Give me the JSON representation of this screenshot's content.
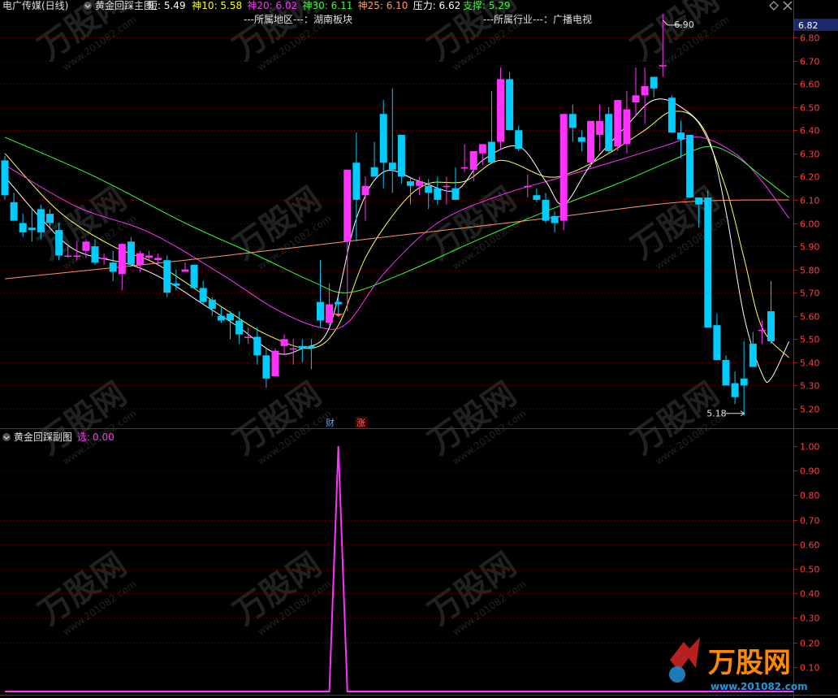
{
  "header": {
    "stock_name": "电广传媒(日线)",
    "indicator_name": "黄金回踩主图",
    "items": [
      {
        "label": "短: ",
        "value": "5.49",
        "color": "#ffffff"
      },
      {
        "label": "神10: ",
        "value": "5.58",
        "color": "#ffff00"
      },
      {
        "label": "神20: ",
        "value": "6.02",
        "color": "#ff33ff"
      },
      {
        "label": "神30: ",
        "value": "6.11",
        "color": "#33ff33"
      },
      {
        "label": "神25: ",
        "value": "6.10",
        "color": "#ff9966"
      },
      {
        "label": "压力: ",
        "value": "6.62",
        "color": "#ffffff"
      },
      {
        "label": "支撑: ",
        "value": "5.29",
        "color": "#33ff33"
      }
    ],
    "region_text": "---所属地区---：湖南板块",
    "industry_text": "---所属行业---：广播电视",
    "close_icon": "close-icon",
    "settings_icon": "diamond-icon"
  },
  "sub_header": {
    "indicator_name": "黄金回踩副图",
    "item_label": "选: ",
    "item_value": "0.00",
    "item_color": "#ff33ff"
  },
  "markers": {
    "cai": "财",
    "zhang": "涨"
  },
  "watermark": {
    "brand": "万股网",
    "url": "www.201082.com"
  },
  "chart_data": [
    {
      "type": "candlestick",
      "title": "黄金回踩主图",
      "price_range": [
        5.15,
        6.86
      ],
      "y_ticks": [
        "6.80",
        "6.70",
        "6.60",
        "6.50",
        "6.40",
        "6.30",
        "6.20",
        "6.10",
        "6.00",
        "5.90",
        "5.80",
        "5.70",
        "5.60",
        "5.50",
        "5.40",
        "5.30",
        "5.20"
      ],
      "current_price_label": "6.82",
      "high_annotation": "6.90",
      "low_annotation": "5.18",
      "up_color": "#ff33ff",
      "down_color": "#00ccff",
      "candles": [
        [
          6.27,
          6.29,
          6.1,
          6.12
        ],
        [
          6.09,
          6.13,
          6.01,
          6.01
        ],
        [
          6.0,
          6.04,
          5.94,
          5.96
        ],
        [
          5.98,
          6.06,
          5.92,
          5.97
        ],
        [
          6.06,
          6.08,
          5.93,
          5.96
        ],
        [
          6.04,
          6.06,
          5.98,
          6.0
        ],
        [
          5.97,
          6.0,
          5.84,
          5.86
        ],
        [
          5.86,
          5.9,
          5.85,
          5.86
        ],
        [
          5.86,
          5.92,
          5.84,
          5.86
        ],
        [
          5.88,
          5.93,
          5.85,
          5.92
        ],
        [
          5.9,
          5.93,
          5.82,
          5.83
        ],
        [
          5.85,
          5.87,
          5.82,
          5.85
        ],
        [
          5.83,
          5.88,
          5.75,
          5.79
        ],
        [
          5.78,
          5.91,
          5.71,
          5.91
        ],
        [
          5.92,
          5.94,
          5.81,
          5.82
        ],
        [
          5.82,
          5.88,
          5.79,
          5.87
        ],
        [
          5.85,
          5.88,
          5.84,
          5.86
        ],
        [
          5.84,
          5.87,
          5.82,
          5.85
        ],
        [
          5.84,
          5.86,
          5.68,
          5.7
        ],
        [
          5.74,
          5.8,
          5.71,
          5.73
        ],
        [
          5.79,
          5.83,
          5.79,
          5.8
        ],
        [
          5.82,
          5.82,
          5.72,
          5.72
        ],
        [
          5.72,
          5.75,
          5.65,
          5.66
        ],
        [
          5.67,
          5.68,
          5.6,
          5.63
        ],
        [
          5.6,
          5.64,
          5.57,
          5.58
        ],
        [
          5.61,
          5.62,
          5.5,
          5.58
        ],
        [
          5.58,
          5.62,
          5.48,
          5.52
        ],
        [
          5.51,
          5.55,
          5.48,
          5.51
        ],
        [
          5.51,
          5.55,
          5.39,
          5.43
        ],
        [
          5.43,
          5.46,
          5.29,
          5.33
        ],
        [
          5.34,
          5.46,
          5.34,
          5.45
        ],
        [
          5.47,
          5.52,
          5.43,
          5.5
        ],
        [
          5.46,
          5.5,
          5.39,
          5.46
        ],
        [
          5.47,
          5.5,
          5.4,
          5.46
        ],
        [
          5.47,
          5.5,
          5.37,
          5.46
        ],
        [
          5.66,
          5.84,
          5.55,
          5.58
        ],
        [
          5.57,
          5.74,
          5.56,
          5.65
        ],
        [
          5.66,
          5.68,
          5.6,
          5.65
        ],
        [
          5.92,
          6.23,
          5.62,
          6.23
        ],
        [
          6.26,
          6.39,
          5.92,
          6.1
        ],
        [
          6.12,
          6.2,
          6.01,
          6.16
        ],
        [
          6.24,
          6.35,
          6.21,
          6.2
        ],
        [
          6.47,
          6.53,
          6.15,
          6.26
        ],
        [
          6.26,
          6.58,
          6.13,
          6.23
        ],
        [
          6.38,
          6.38,
          6.17,
          6.2
        ],
        [
          6.18,
          6.2,
          6.08,
          6.16
        ],
        [
          6.16,
          6.2,
          6.12,
          6.18
        ],
        [
          6.16,
          6.19,
          6.06,
          6.13
        ],
        [
          6.15,
          6.2,
          6.08,
          6.1
        ],
        [
          6.16,
          6.2,
          6.08,
          6.16
        ],
        [
          6.15,
          6.24,
          6.1,
          6.1
        ],
        [
          6.24,
          6.34,
          6.22,
          6.24
        ],
        [
          6.23,
          6.31,
          6.18,
          6.31
        ],
        [
          6.3,
          6.34,
          6.25,
          6.34
        ],
        [
          6.35,
          6.57,
          6.28,
          6.26
        ],
        [
          6.35,
          6.67,
          6.32,
          6.62
        ],
        [
          6.62,
          6.65,
          6.4,
          6.4
        ],
        [
          6.4,
          6.42,
          6.31,
          6.32
        ],
        [
          6.16,
          6.21,
          6.11,
          6.16
        ],
        [
          6.12,
          6.15,
          6.09,
          6.1
        ],
        [
          6.1,
          6.13,
          6.0,
          6.01
        ],
        [
          6.03,
          6.05,
          5.96,
          6.0
        ],
        [
          6.01,
          6.47,
          5.97,
          6.47
        ],
        [
          6.47,
          6.51,
          6.35,
          6.41
        ],
        [
          6.37,
          6.4,
          6.31,
          6.35
        ],
        [
          6.26,
          6.44,
          6.24,
          6.44
        ],
        [
          6.38,
          6.51,
          6.31,
          6.44
        ],
        [
          6.47,
          6.5,
          6.3,
          6.31
        ],
        [
          6.33,
          6.53,
          6.31,
          6.53
        ],
        [
          6.34,
          6.57,
          6.3,
          6.49
        ],
        [
          6.52,
          6.67,
          6.46,
          6.55
        ],
        [
          6.55,
          6.67,
          6.43,
          6.59
        ],
        [
          6.63,
          6.63,
          6.54,
          6.58
        ],
        [
          6.68,
          6.9,
          6.63,
          6.68
        ],
        [
          6.54,
          6.55,
          6.39,
          6.39
        ],
        [
          6.39,
          6.44,
          6.28,
          6.36
        ],
        [
          6.38,
          6.38,
          6.15,
          6.11
        ],
        [
          6.11,
          6.11,
          5.98,
          6.08
        ],
        [
          6.11,
          6.14,
          5.55,
          5.55
        ],
        [
          5.56,
          5.61,
          5.41,
          5.41
        ],
        [
          5.41,
          5.43,
          5.3,
          5.3
        ],
        [
          5.31,
          5.36,
          5.22,
          5.25
        ],
        [
          5.33,
          5.49,
          5.17,
          5.3
        ],
        [
          5.48,
          5.53,
          5.38,
          5.38
        ],
        [
          5.54,
          5.58,
          5.48,
          5.54
        ],
        [
          5.62,
          5.75,
          5.48,
          5.49
        ]
      ],
      "ma_lines": [
        {
          "name": "神10",
          "color": "#ffff55",
          "points": [
            [
              0,
              6.3
            ],
            [
              6,
              6.05
            ],
            [
              12,
              5.9
            ],
            [
              17,
              5.82
            ],
            [
              24,
              5.64
            ],
            [
              29,
              5.52
            ],
            [
              34,
              5.46
            ],
            [
              37,
              5.56
            ],
            [
              40,
              5.85
            ],
            [
              44,
              6.08
            ],
            [
              47,
              6.17
            ],
            [
              51,
              6.18
            ],
            [
              55,
              6.27
            ],
            [
              60,
              6.2
            ],
            [
              63,
              6.22
            ],
            [
              67,
              6.3
            ],
            [
              71,
              6.4
            ],
            [
              74,
              6.48
            ],
            [
              77,
              6.43
            ],
            [
              80,
              6.15
            ],
            [
              82,
              5.85
            ],
            [
              84,
              5.55
            ],
            [
              87,
              5.42
            ]
          ]
        },
        {
          "name": "神20",
          "color": "#ff33ff",
          "points": [
            [
              0,
              6.25
            ],
            [
              8,
              6.07
            ],
            [
              16,
              5.96
            ],
            [
              24,
              5.78
            ],
            [
              30,
              5.63
            ],
            [
              35,
              5.55
            ],
            [
              38,
              5.57
            ],
            [
              42,
              5.78
            ],
            [
              48,
              6.0
            ],
            [
              55,
              6.12
            ],
            [
              62,
              6.2
            ],
            [
              68,
              6.27
            ],
            [
              73,
              6.33
            ],
            [
              77,
              6.37
            ],
            [
              81,
              6.3
            ],
            [
              84,
              6.18
            ],
            [
              87,
              6.02
            ]
          ]
        },
        {
          "name": "神30",
          "color": "#33ff33",
          "points": [
            [
              0,
              6.37
            ],
            [
              10,
              6.2
            ],
            [
              20,
              6.0
            ],
            [
              28,
              5.86
            ],
            [
              34,
              5.75
            ],
            [
              38,
              5.7
            ],
            [
              44,
              5.78
            ],
            [
              52,
              5.92
            ],
            [
              60,
              6.05
            ],
            [
              68,
              6.17
            ],
            [
              74,
              6.27
            ],
            [
              78,
              6.33
            ],
            [
              81,
              6.29
            ],
            [
              84,
              6.2
            ],
            [
              87,
              6.11
            ]
          ]
        },
        {
          "name": "神25",
          "color": "#ff9966",
          "points": [
            [
              0,
              5.76
            ],
            [
              20,
              5.84
            ],
            [
              40,
              5.93
            ],
            [
              60,
              6.02
            ],
            [
              75,
              6.09
            ],
            [
              87,
              6.1
            ]
          ]
        },
        {
          "name": "短",
          "color": "#ffffff",
          "points": [
            [
              0,
              6.2
            ],
            [
              4,
              6.02
            ],
            [
              8,
              5.88
            ],
            [
              14,
              5.82
            ],
            [
              18,
              5.75
            ],
            [
              22,
              5.65
            ],
            [
              26,
              5.55
            ],
            [
              30,
              5.44
            ],
            [
              33,
              5.46
            ],
            [
              36,
              5.55
            ],
            [
              39,
              6.02
            ],
            [
              42,
              6.22
            ],
            [
              46,
              6.18
            ],
            [
              50,
              6.14
            ],
            [
              53,
              6.27
            ],
            [
              57,
              6.33
            ],
            [
              60,
              6.18
            ],
            [
              62,
              6.08
            ],
            [
              65,
              6.25
            ],
            [
              69,
              6.42
            ],
            [
              72,
              6.53
            ],
            [
              75,
              6.5
            ],
            [
              78,
              6.37
            ],
            [
              80,
              6.05
            ],
            [
              82,
              5.6
            ],
            [
              84,
              5.35
            ],
            [
              85,
              5.33
            ],
            [
              87,
              5.49
            ]
          ]
        }
      ]
    },
    {
      "type": "line",
      "title": "黄金回踩副图",
      "series": [
        {
          "name": "选",
          "values": [
            0,
            0,
            0,
            0,
            0,
            0,
            0,
            0,
            0,
            0,
            0,
            0,
            0,
            0,
            0,
            0,
            0,
            0,
            0,
            0,
            0,
            0,
            0,
            0,
            0,
            0,
            0,
            0,
            0,
            0,
            0,
            0,
            0,
            0,
            0,
            0,
            0,
            1,
            0,
            0,
            0,
            0,
            0,
            0,
            0,
            0,
            0,
            0,
            0,
            0,
            0,
            0,
            0,
            0,
            0,
            0,
            0,
            0,
            0,
            0,
            0,
            0,
            0,
            0,
            0,
            0,
            0,
            0,
            0,
            0,
            0,
            0,
            0,
            0,
            0,
            0,
            0,
            0,
            0,
            0,
            0,
            0,
            0,
            0,
            0,
            0,
            0,
            0
          ]
        }
      ],
      "ylim": [
        0,
        1.0
      ],
      "y_ticks": [
        "1.00",
        "0.90",
        "0.80",
        "0.70",
        "0.60",
        "0.50",
        "0.40",
        "0.30",
        "0.20",
        "0.10"
      ]
    }
  ]
}
